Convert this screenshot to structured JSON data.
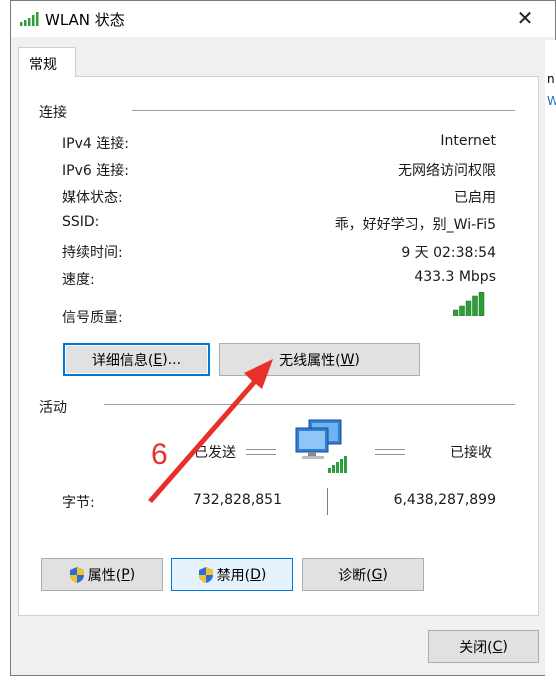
{
  "window": {
    "title": "WLAN 状态",
    "icon": "wifi-signal-icon",
    "close_label": "✕"
  },
  "background_right_edge": [
    "n",
    "W"
  ],
  "tabs": [
    {
      "label": "常规",
      "selected": true
    }
  ],
  "connection": {
    "heading": "连接",
    "rows": [
      {
        "label": "IPv4 连接:",
        "value": "Internet"
      },
      {
        "label": "IPv6 连接:",
        "value": "无网络访问权限"
      },
      {
        "label": "媒体状态:",
        "value": "已启用"
      },
      {
        "label": "SSID:",
        "value": "乖，好好学习，别_Wi-Fi5"
      },
      {
        "label": "持续时间:",
        "value": "9 天 02:38:54"
      },
      {
        "label": "速度:",
        "value": "433.3 Mbps"
      }
    ],
    "signal_label": "信号质量:",
    "signal_bars": 5,
    "details_button": {
      "text": "详细信息(",
      "key": "E",
      "suffix": ")..."
    },
    "wireless_button": {
      "text": "无线属性(",
      "key": "W",
      "suffix": ")"
    }
  },
  "activity": {
    "heading": "活动",
    "sent_label": "已发送",
    "received_label": "已接收",
    "bytes_label": "字节:",
    "bytes_sent": "732,828,851",
    "bytes_received": "6,438,287,899"
  },
  "bottom_buttons": [
    {
      "text": "属性(",
      "key": "P",
      "suffix": ")",
      "icon": "shield-icon"
    },
    {
      "text": "禁用(",
      "key": "D",
      "suffix": ")",
      "icon": "shield-icon"
    },
    {
      "text": "诊断(",
      "key": "G",
      "suffix": ")"
    }
  ],
  "close_button": {
    "text": "关闭(",
    "key": "C",
    "suffix": ")"
  },
  "annotation": {
    "number": "6",
    "color": "#e8302a"
  },
  "colors": {
    "accent": "#0078d7",
    "signal_green": "#2e9e3a",
    "annotation_red": "#e8302a"
  }
}
